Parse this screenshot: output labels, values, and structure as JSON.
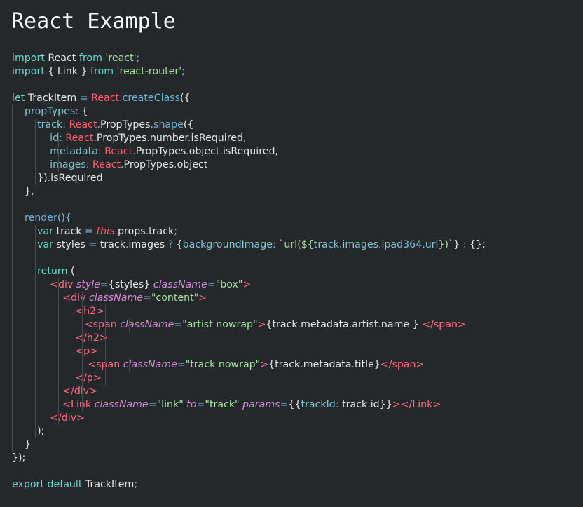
{
  "page": {
    "title": "React Example"
  },
  "code": {
    "lines": [
      [
        {
          "c": "k",
          "t": "import"
        },
        {
          "c": "i",
          "t": " React "
        },
        {
          "c": "k",
          "t": "from"
        },
        {
          "c": "i",
          "t": " "
        },
        {
          "c": "s",
          "t": "'react'"
        },
        {
          "c": "o",
          "t": ";"
        }
      ],
      [
        {
          "c": "k",
          "t": "import"
        },
        {
          "c": "i",
          "t": " { Link } "
        },
        {
          "c": "k",
          "t": "from"
        },
        {
          "c": "i",
          "t": " "
        },
        {
          "c": "s",
          "t": "'react-router'"
        },
        {
          "c": "o",
          "t": ";"
        }
      ],
      [],
      [
        {
          "c": "k",
          "t": "let"
        },
        {
          "c": "i",
          "t": " TrackItem "
        },
        {
          "c": "o",
          "t": "="
        },
        {
          "c": "i",
          "t": " "
        },
        {
          "c": "r",
          "t": "React"
        },
        {
          "c": "o",
          "t": "."
        },
        {
          "c": "f",
          "t": "createClass"
        },
        {
          "c": "i",
          "t": "({"
        }
      ],
      [
        {
          "c": "i",
          "t": "    "
        },
        {
          "c": "p",
          "t": "propTypes"
        },
        {
          "c": "o",
          "t": ":"
        },
        {
          "c": "i",
          "t": " {"
        }
      ],
      [
        {
          "c": "i",
          "t": "        "
        },
        {
          "c": "p",
          "t": "track"
        },
        {
          "c": "o",
          "t": ":"
        },
        {
          "c": "i",
          "t": " "
        },
        {
          "c": "r",
          "t": "React"
        },
        {
          "c": "o",
          "t": "."
        },
        {
          "c": "i",
          "t": "PropTypes"
        },
        {
          "c": "o",
          "t": "."
        },
        {
          "c": "f",
          "t": "shape"
        },
        {
          "c": "i",
          "t": "({"
        }
      ],
      [
        {
          "c": "i",
          "t": "            "
        },
        {
          "c": "p",
          "t": "id"
        },
        {
          "c": "o",
          "t": ":"
        },
        {
          "c": "i",
          "t": " "
        },
        {
          "c": "r",
          "t": "React"
        },
        {
          "c": "o",
          "t": "."
        },
        {
          "c": "i",
          "t": "PropTypes"
        },
        {
          "c": "o",
          "t": "."
        },
        {
          "c": "i",
          "t": "number"
        },
        {
          "c": "o",
          "t": "."
        },
        {
          "c": "i",
          "t": "isRequired,"
        }
      ],
      [
        {
          "c": "i",
          "t": "            "
        },
        {
          "c": "p",
          "t": "metadata"
        },
        {
          "c": "o",
          "t": ":"
        },
        {
          "c": "i",
          "t": " "
        },
        {
          "c": "r",
          "t": "React"
        },
        {
          "c": "o",
          "t": "."
        },
        {
          "c": "i",
          "t": "PropTypes"
        },
        {
          "c": "o",
          "t": "."
        },
        {
          "c": "i",
          "t": "object"
        },
        {
          "c": "o",
          "t": "."
        },
        {
          "c": "i",
          "t": "isRequired,"
        }
      ],
      [
        {
          "c": "i",
          "t": "            "
        },
        {
          "c": "p",
          "t": "images"
        },
        {
          "c": "o",
          "t": ":"
        },
        {
          "c": "i",
          "t": " "
        },
        {
          "c": "r",
          "t": "React"
        },
        {
          "c": "o",
          "t": "."
        },
        {
          "c": "i",
          "t": "PropTypes"
        },
        {
          "c": "o",
          "t": "."
        },
        {
          "c": "i",
          "t": "object"
        }
      ],
      [
        {
          "c": "i",
          "t": "        })"
        },
        {
          "c": "o",
          "t": "."
        },
        {
          "c": "i",
          "t": "isRequired"
        }
      ],
      [
        {
          "c": "i",
          "t": "    },"
        }
      ],
      [],
      [
        {
          "c": "i",
          "t": "    "
        },
        {
          "c": "f",
          "t": "render"
        },
        {
          "c": "o",
          "t": "(){"
        }
      ],
      [
        {
          "c": "i",
          "t": "        "
        },
        {
          "c": "k",
          "t": "var"
        },
        {
          "c": "i",
          "t": " track "
        },
        {
          "c": "o",
          "t": "="
        },
        {
          "c": "i",
          "t": " "
        },
        {
          "c": "th",
          "t": "this"
        },
        {
          "c": "o",
          "t": "."
        },
        {
          "c": "i",
          "t": "props"
        },
        {
          "c": "o",
          "t": "."
        },
        {
          "c": "i",
          "t": "track"
        },
        {
          "c": "o",
          "t": ";"
        }
      ],
      [
        {
          "c": "i",
          "t": "        "
        },
        {
          "c": "k",
          "t": "var"
        },
        {
          "c": "i",
          "t": " styles "
        },
        {
          "c": "o",
          "t": "="
        },
        {
          "c": "i",
          "t": " track"
        },
        {
          "c": "o",
          "t": "."
        },
        {
          "c": "i",
          "t": "images "
        },
        {
          "c": "o",
          "t": "?"
        },
        {
          "c": "i",
          "t": " {"
        },
        {
          "c": "p",
          "t": "backgroundImage"
        },
        {
          "c": "o",
          "t": ":"
        },
        {
          "c": "i",
          "t": " "
        },
        {
          "c": "tmpl",
          "t": "`url(${"
        },
        {
          "c": "tmplv",
          "t": "track.images.ipad364.url"
        },
        {
          "c": "tmpl",
          "t": "})`"
        },
        {
          "c": "i",
          "t": "} "
        },
        {
          "c": "o",
          "t": ":"
        },
        {
          "c": "i",
          "t": " {};"
        }
      ],
      [],
      [
        {
          "c": "i",
          "t": "        "
        },
        {
          "c": "k",
          "t": "return"
        },
        {
          "c": "i",
          "t": " ("
        }
      ],
      [
        {
          "c": "i",
          "t": "            "
        },
        {
          "c": "t",
          "t": "<div"
        },
        {
          "c": "i",
          "t": " "
        },
        {
          "c": "a",
          "t": "style"
        },
        {
          "c": "o",
          "t": "="
        },
        {
          "c": "i",
          "t": "{styles} "
        },
        {
          "c": "a",
          "t": "className"
        },
        {
          "c": "o",
          "t": "="
        },
        {
          "c": "s",
          "t": "\"box\""
        },
        {
          "c": "t",
          "t": ">"
        }
      ],
      [
        {
          "c": "i",
          "t": "                "
        },
        {
          "c": "t",
          "t": "<div"
        },
        {
          "c": "i",
          "t": " "
        },
        {
          "c": "a",
          "t": "className"
        },
        {
          "c": "o",
          "t": "="
        },
        {
          "c": "s",
          "t": "\"content\""
        },
        {
          "c": "t",
          "t": ">"
        }
      ],
      [
        {
          "c": "i",
          "t": "                    "
        },
        {
          "c": "t",
          "t": "<h2>"
        }
      ],
      [
        {
          "c": "i",
          "t": "                       "
        },
        {
          "c": "t",
          "t": "<span"
        },
        {
          "c": "i",
          "t": " "
        },
        {
          "c": "a",
          "t": "className"
        },
        {
          "c": "o",
          "t": "="
        },
        {
          "c": "s",
          "t": "\"artist nowrap\""
        },
        {
          "c": "t",
          "t": ">"
        },
        {
          "c": "i",
          "t": "{track"
        },
        {
          "c": "o",
          "t": "."
        },
        {
          "c": "i",
          "t": "metadata"
        },
        {
          "c": "o",
          "t": "."
        },
        {
          "c": "i",
          "t": "artist"
        },
        {
          "c": "o",
          "t": "."
        },
        {
          "c": "i",
          "t": "name } "
        },
        {
          "c": "t",
          "t": "</span>"
        }
      ],
      [
        {
          "c": "i",
          "t": "                    "
        },
        {
          "c": "t",
          "t": "</h2>"
        }
      ],
      [
        {
          "c": "i",
          "t": "                    "
        },
        {
          "c": "t",
          "t": "<p>"
        }
      ],
      [
        {
          "c": "i",
          "t": "                        "
        },
        {
          "c": "t",
          "t": "<span"
        },
        {
          "c": "i",
          "t": " "
        },
        {
          "c": "a",
          "t": "className"
        },
        {
          "c": "o",
          "t": "="
        },
        {
          "c": "s",
          "t": "\"track nowrap\""
        },
        {
          "c": "t",
          "t": ">"
        },
        {
          "c": "i",
          "t": "{track"
        },
        {
          "c": "o",
          "t": "."
        },
        {
          "c": "i",
          "t": "metadata"
        },
        {
          "c": "o",
          "t": "."
        },
        {
          "c": "i",
          "t": "title}"
        },
        {
          "c": "t",
          "t": "</span>"
        }
      ],
      [
        {
          "c": "i",
          "t": "                    "
        },
        {
          "c": "t",
          "t": "</p>"
        }
      ],
      [
        {
          "c": "i",
          "t": "                "
        },
        {
          "c": "t",
          "t": "</div>"
        }
      ],
      [
        {
          "c": "i",
          "t": "                "
        },
        {
          "c": "t",
          "t": "<Link"
        },
        {
          "c": "i",
          "t": " "
        },
        {
          "c": "a",
          "t": "className"
        },
        {
          "c": "o",
          "t": "="
        },
        {
          "c": "s",
          "t": "\"link\""
        },
        {
          "c": "i",
          "t": " "
        },
        {
          "c": "a",
          "t": "to"
        },
        {
          "c": "o",
          "t": "="
        },
        {
          "c": "s",
          "t": "\"track\""
        },
        {
          "c": "i",
          "t": " "
        },
        {
          "c": "a",
          "t": "params"
        },
        {
          "c": "o",
          "t": "="
        },
        {
          "c": "i",
          "t": "{{"
        },
        {
          "c": "p",
          "t": "trackId"
        },
        {
          "c": "o",
          "t": ":"
        },
        {
          "c": "i",
          "t": " track"
        },
        {
          "c": "o",
          "t": "."
        },
        {
          "c": "i",
          "t": "id}}"
        },
        {
          "c": "t",
          "t": "></Link>"
        }
      ],
      [
        {
          "c": "i",
          "t": "            "
        },
        {
          "c": "t",
          "t": "</div>"
        }
      ],
      [
        {
          "c": "i",
          "t": "        );"
        }
      ],
      [
        {
          "c": "i",
          "t": "    }"
        }
      ],
      [
        {
          "c": "i",
          "t": "});"
        }
      ],
      [],
      [
        {
          "c": "k",
          "t": "export"
        },
        {
          "c": "i",
          "t": " "
        },
        {
          "c": "k",
          "t": "default"
        },
        {
          "c": "i",
          "t": " TrackItem"
        },
        {
          "c": "o",
          "t": ";"
        }
      ]
    ],
    "guides": [
      [],
      [],
      [],
      [],
      [
        1
      ],
      [
        1,
        2
      ],
      [
        1,
        2,
        3
      ],
      [
        1,
        2,
        3
      ],
      [
        1,
        2,
        3
      ],
      [
        1,
        2
      ],
      [
        1
      ],
      [
        1
      ],
      [
        1
      ],
      [
        1,
        2
      ],
      [
        1,
        2
      ],
      [
        1,
        2
      ],
      [
        1,
        2
      ],
      [
        1,
        2,
        3
      ],
      [
        1,
        2,
        3,
        4
      ],
      [
        1,
        2,
        3,
        4,
        5
      ],
      [
        1,
        2,
        3,
        4,
        5,
        6
      ],
      [
        1,
        2,
        3,
        4,
        5
      ],
      [
        1,
        2,
        3,
        4,
        5
      ],
      [
        1,
        2,
        3,
        4,
        5,
        6
      ],
      [
        1,
        2,
        3,
        4,
        5
      ],
      [
        1,
        2,
        3,
        4
      ],
      [
        1,
        2,
        3,
        4
      ],
      [
        1,
        2,
        3
      ],
      [
        1,
        2
      ],
      [
        1
      ],
      [],
      [],
      []
    ]
  }
}
